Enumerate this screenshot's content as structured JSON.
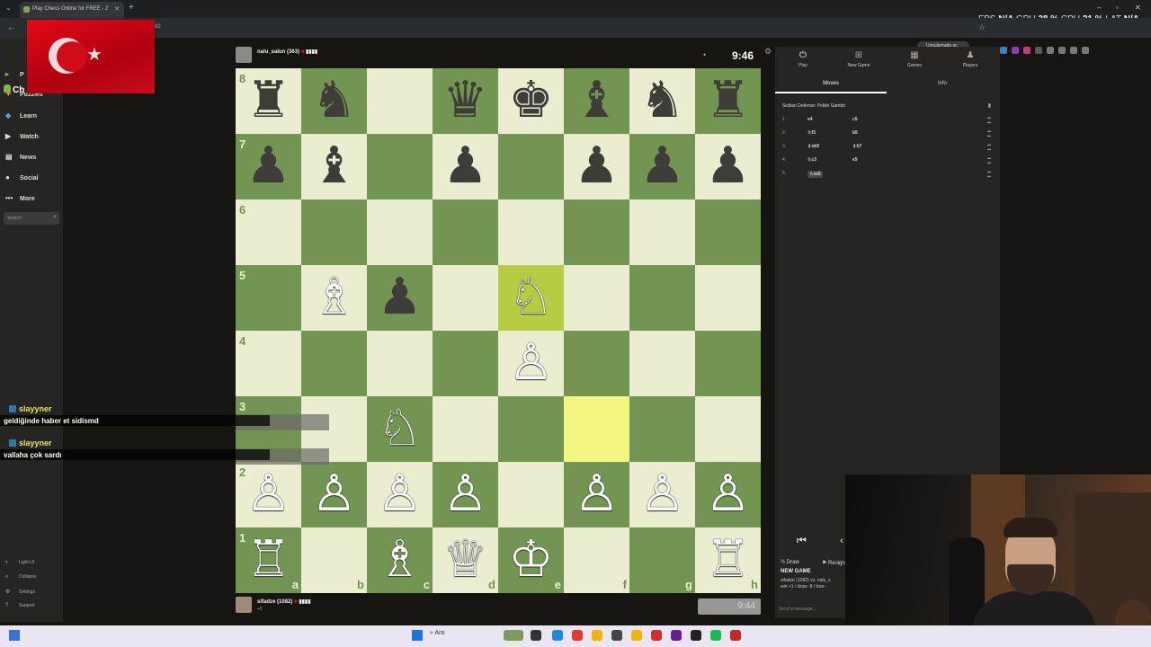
{
  "browser": {
    "tab_title": "Play Chess Online for FREE - 2",
    "url_fragment": "92",
    "app_button": "Uygulamada aç",
    "perf_labels": {
      "fps_label": "FPS",
      "fps": "N/A",
      "gpu_label": "GPU",
      "gpu": "28 %",
      "cpu_label": "CPU",
      "cpu": "21 %",
      "lat_label": "LAT",
      "lat": "N/A"
    }
  },
  "sidebar": {
    "logo": "Ch",
    "items": [
      {
        "label": "P",
        "icon": "play-icon"
      },
      {
        "label": "Puzzles",
        "icon": "puzzle-icon"
      },
      {
        "label": "Learn",
        "icon": "learn-icon"
      },
      {
        "label": "Watch",
        "icon": "watch-icon"
      },
      {
        "label": "News",
        "icon": "news-icon"
      },
      {
        "label": "Social",
        "icon": "social-icon"
      },
      {
        "label": "More",
        "icon": "more-icon"
      }
    ],
    "search_placeholder": "Search",
    "bottom": [
      {
        "label": "Light UI",
        "icon": "light-ui-icon"
      },
      {
        "label": "Collapse",
        "icon": "collapse-icon"
      },
      {
        "label": "Settings",
        "icon": "gear-icon"
      },
      {
        "label": "Support",
        "icon": "help-icon"
      }
    ]
  },
  "chat": [
    {
      "user": "slayyner",
      "text": "geldiğinde haber et sidismd"
    },
    {
      "user": "slayyner",
      "text": "vallaha çok sardı"
    }
  ],
  "top_player": {
    "name": "nalu_salun",
    "rating": "(363)",
    "clock": "9:46"
  },
  "bottom_player": {
    "name": "sifadze",
    "rating": "(1082)",
    "sub": "+2",
    "clock": "9:44"
  },
  "board": {
    "ranks": [
      "8",
      "7",
      "6",
      "5",
      "4",
      "3",
      "2",
      "1"
    ],
    "files": [
      "a",
      "b",
      "c",
      "d",
      "e",
      "f",
      "g",
      "h"
    ],
    "squares": [
      [
        "♜",
        "♞",
        "",
        "♛",
        "♚",
        "♝",
        "♞",
        "♜"
      ],
      [
        "♟",
        "♝",
        "",
        "♟",
        "",
        "♟",
        "♟",
        "♟"
      ],
      [
        "",
        "",
        "",
        "",
        "",
        "",
        "",
        ""
      ],
      [
        "",
        "♗",
        "♟",
        "",
        "♘",
        "",
        "",
        ""
      ],
      [
        "",
        "",
        "",
        "",
        "♙",
        "",
        "",
        ""
      ],
      [
        "",
        "",
        "♘",
        "",
        "",
        "",
        "",
        ""
      ],
      [
        "♙",
        "♙",
        "♙",
        "♙",
        "",
        "♙",
        "♙",
        "♙"
      ],
      [
        "♖",
        "",
        "♗",
        "♕",
        "♔",
        "",
        "",
        "♖"
      ]
    ],
    "colors": [
      [
        "b",
        "b",
        "",
        "b",
        "b",
        "b",
        "b",
        "b"
      ],
      [
        "b",
        "b",
        "",
        "b",
        "",
        "b",
        "b",
        "b"
      ],
      [
        "",
        "",
        "",
        "",
        "",
        "",
        "",
        ""
      ],
      [
        "",
        "w",
        "b",
        "",
        "w",
        "",
        "",
        ""
      ],
      [
        "",
        "",
        "",
        "",
        "w",
        "",
        "",
        ""
      ],
      [
        "",
        "",
        "w",
        "",
        "",
        "",
        "",
        ""
      ],
      [
        "w",
        "w",
        "w",
        "w",
        "",
        "w",
        "w",
        "w"
      ],
      [
        "w",
        "",
        "w",
        "w",
        "w",
        "",
        "",
        "w"
      ]
    ],
    "highlighted": [
      "e5",
      "f3"
    ]
  },
  "panel": {
    "tabs": [
      {
        "label": "Play",
        "icon": "play-icon"
      },
      {
        "label": "New Game",
        "icon": "plus-icon"
      },
      {
        "label": "Games",
        "icon": "games-icon"
      },
      {
        "label": "Players",
        "icon": "players-icon"
      }
    ],
    "subtabs": [
      "Moves",
      "Info"
    ],
    "opening": "Sicilian Defense: Polish Gambit",
    "moves": [
      {
        "num": "1.",
        "white": "e4",
        "black": "c5"
      },
      {
        "num": "2.",
        "white": "♘f3",
        "black": "b5"
      },
      {
        "num": "3.",
        "white": "♗xb5",
        "black": "♗b7"
      },
      {
        "num": "4.",
        "white": "♘c3",
        "black": "e5"
      },
      {
        "num": "5.",
        "white": "♘xe5",
        "black": ""
      }
    ],
    "draw_label": "Draw",
    "resign_label": "Resign",
    "new_game_label": "NEW GAME",
    "game_info_1": "sifadze (1082) vs. nalu_s",
    "game_info_2": "win +1 / draw -8 / lose -",
    "send_placeholder": "Send a message..."
  },
  "taskbar": {
    "search": "Ara"
  }
}
